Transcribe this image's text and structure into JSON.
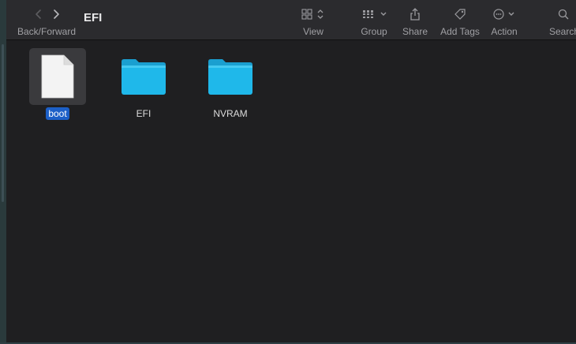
{
  "window": {
    "title": "EFI"
  },
  "toolbar": {
    "back_forward_label": "Back/Forward",
    "view_label": "View",
    "group_label": "Group",
    "share_label": "Share",
    "add_tags_label": "Add Tags",
    "action_label": "Action",
    "search_label": "Search"
  },
  "files": [
    {
      "name": "boot",
      "kind": "document",
      "selected": true
    },
    {
      "name": "EFI",
      "kind": "folder",
      "selected": false
    },
    {
      "name": "NVRAM",
      "kind": "folder",
      "selected": false
    }
  ],
  "colors": {
    "folder": "#1fb8ea",
    "selection": "#1c5fc7",
    "toolbar": "#2b2b2e",
    "background": "#1f1f21"
  }
}
